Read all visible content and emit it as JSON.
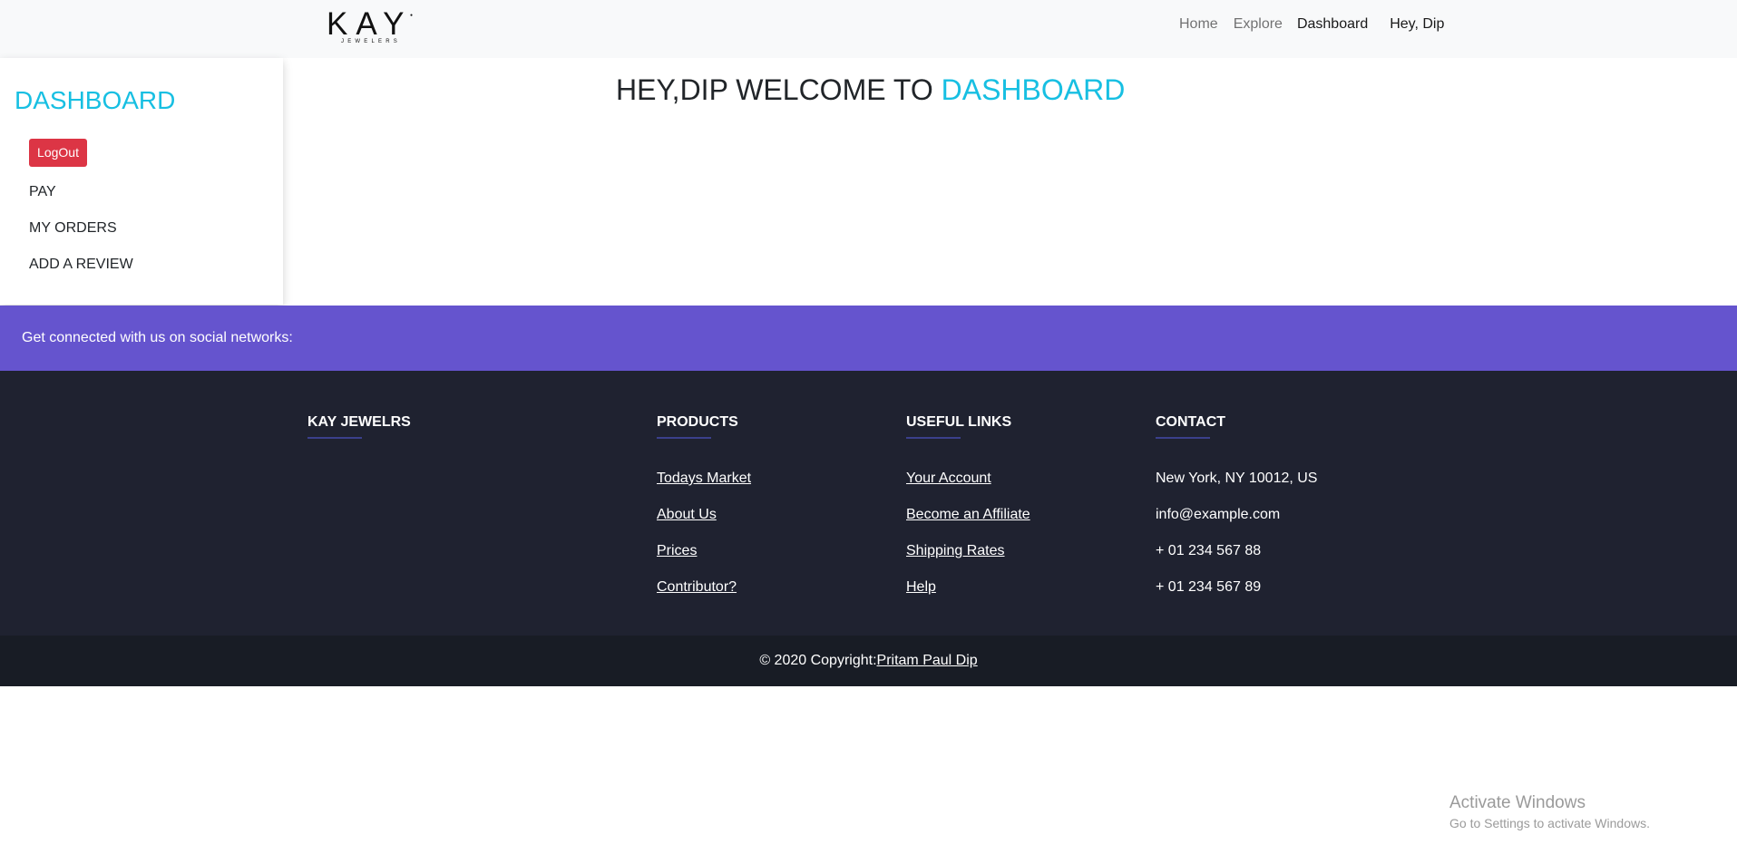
{
  "navbar": {
    "logo_main": "KAY",
    "logo_sub": "JEWELERS",
    "links": {
      "home": "Home",
      "explore": "Explore",
      "dashboard": "Dashboard"
    },
    "user_greeting": "Hey, Dip"
  },
  "sidebar": {
    "title": "DASHBOARD",
    "logout_label": "LogOut",
    "links": [
      "PAY",
      "MY ORDERS",
      "ADD A REVIEW"
    ]
  },
  "main": {
    "welcome_prefix": "HEY,DIP WELCOME TO ",
    "welcome_accent": "DASHBOARD"
  },
  "social": {
    "text": "Get connected with us on social networks:"
  },
  "footer": {
    "brand": {
      "heading": "KAY JEWELRS"
    },
    "products": {
      "heading": "PRODUCTS",
      "items": [
        "Todays Market",
        "About Us",
        "Prices",
        "Contributor?"
      ]
    },
    "useful_links": {
      "heading": "USEFUL LINKS",
      "items": [
        "Your Account",
        "Become an Affiliate",
        "Shipping Rates",
        "Help"
      ]
    },
    "contact": {
      "heading": "CONTACT",
      "items": [
        "New York, NY 10012, US",
        "info@example.com",
        "+ 01 234 567 88",
        "+ 01 234 567 89"
      ]
    },
    "copyright_prefix": "© 2020 Copyright:",
    "copyright_link": "Pritam Paul Dip"
  },
  "watermark": {
    "title": "Activate Windows",
    "subtitle": "Go to Settings to activate Windows."
  },
  "colors": {
    "accent": "#17bfe2",
    "logout": "#dc3545",
    "social_strip": "#6554ce",
    "footer_bg": "#1f2230",
    "copyright_bg": "#181c25"
  }
}
